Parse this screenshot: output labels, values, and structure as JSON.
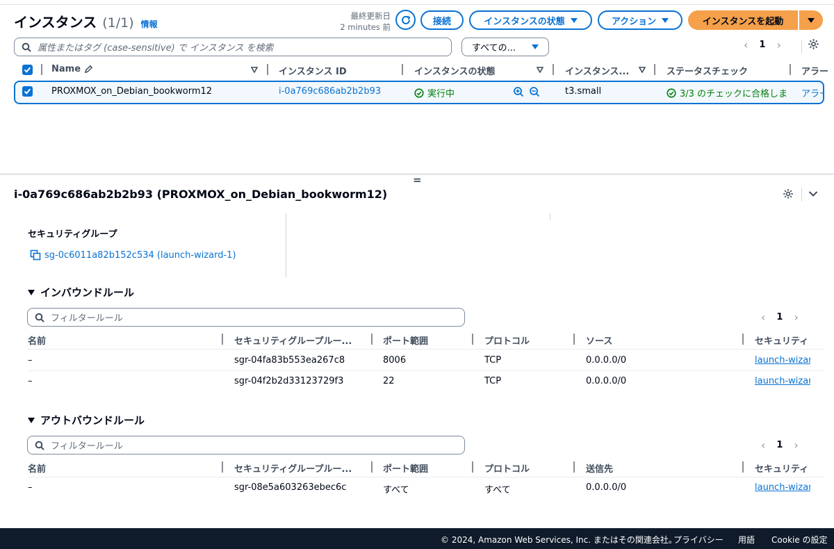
{
  "header": {
    "title": "インスタンス",
    "count": "(1/1)",
    "info_link": "情報",
    "last_updated_label": "最終更新日",
    "last_updated_value": "2 minutes 前",
    "connect_button": "接続",
    "instance_state_button": "インスタンスの状態",
    "actions_button": "アクション",
    "launch_button": "インスタンスを起動"
  },
  "search": {
    "placeholder": "属性またはタグ (case-sensitive) で インスタンス を検索",
    "filter_select": "すべての..."
  },
  "pager_top": {
    "page": "1"
  },
  "instances_table": {
    "columns": [
      "Name",
      "インスタンス ID",
      "インスタンスの状態",
      "インスタンス...",
      "ステータスチェック",
      "アラー"
    ],
    "rows": [
      {
        "name": "PROXMOX_on_Debian_bookworm12",
        "instance_id": "i-0a769c686ab2b2b93",
        "state": "実行中",
        "type": "t3.small",
        "status_check": "3/3 のチェックに合格しま",
        "alarm": "アラー"
      }
    ]
  },
  "split_handle": "=",
  "detail": {
    "title": "i-0a769c686ab2b2b93 (PROXMOX_on_Debian_bookworm12)",
    "security_groups_label": "セキュリティグループ",
    "security_group_link": "sg-0c6011a82b152c534 (launch-wizard-1)"
  },
  "inbound": {
    "title": "インバウンドルール",
    "filter_placeholder": "フィルタールール",
    "page": "1",
    "columns": [
      "名前",
      "セキュリティグループルー...",
      "ポート範囲",
      "プロトコル",
      "ソース",
      "セキュリティ"
    ],
    "rows": [
      {
        "name": "–",
        "rule_id": "sgr-04fa83b553ea267c8",
        "port": "8006",
        "protocol": "TCP",
        "source": "0.0.0.0/0",
        "sg": "launch-wizar"
      },
      {
        "name": "–",
        "rule_id": "sgr-04f2b2d33123729f3",
        "port": "22",
        "protocol": "TCP",
        "source": "0.0.0.0/0",
        "sg": "launch-wizar"
      }
    ]
  },
  "outbound": {
    "title": "アウトバウンドルール",
    "filter_placeholder": "フィルタールール",
    "page": "1",
    "columns": [
      "名前",
      "セキュリティグループルー...",
      "ポート範囲",
      "プロトコル",
      "送信先",
      "セキュリティ"
    ],
    "rows": [
      {
        "name": "–",
        "rule_id": "sgr-08e5a603263ebec6c",
        "port": "すべて",
        "protocol": "すべて",
        "destination": "0.0.0.0/0",
        "sg": "launch-wizar"
      }
    ]
  },
  "footer": {
    "copyright": "© 2024, Amazon Web Services, Inc. またはその関連会社。",
    "privacy": "プライバシー",
    "terms": "用語",
    "cookie": "Cookie の設定"
  },
  "colors": {
    "accent": "#0972d3",
    "launch_orange": "#f5a04a",
    "success_green": "#037f0c",
    "footer_bg": "#0f1b2a"
  }
}
